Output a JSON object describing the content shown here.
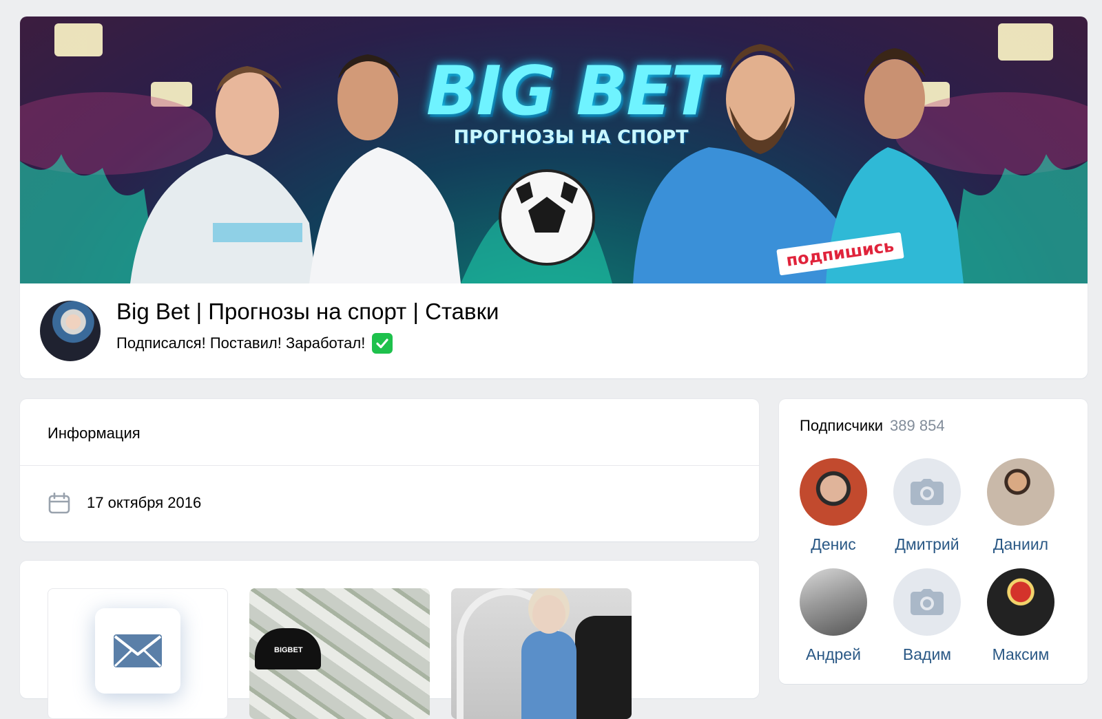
{
  "header": {
    "cover": {
      "title": "BIG BET",
      "subtitle": "ПРОГНОЗЫ НА СПОРТ",
      "cta": "подпишись"
    },
    "name": "Big Bet | Прогнозы на спорт | Ставки",
    "status": "Подписался! Поставил! Заработал!",
    "status_icon": "check-mark-emoji"
  },
  "info": {
    "title": "Информация",
    "date_icon": "calendar-icon",
    "date": "17 октября 2016"
  },
  "media": {
    "tiles": [
      "message-icon",
      "photo-money-cap",
      "photo-girl"
    ],
    "cap_text": "BIGBET"
  },
  "subscribers": {
    "title": "Подписчики",
    "count": "389 854",
    "items": [
      {
        "name": "Денис"
      },
      {
        "name": "Дмитрий"
      },
      {
        "name": "Даниил"
      },
      {
        "name": "Андрей"
      },
      {
        "name": "Вадим"
      },
      {
        "name": "Максим"
      }
    ]
  },
  "colors": {
    "background": "#edeef0",
    "link": "#2a5885",
    "muted": "#818c99",
    "check": "#1ec14c"
  }
}
